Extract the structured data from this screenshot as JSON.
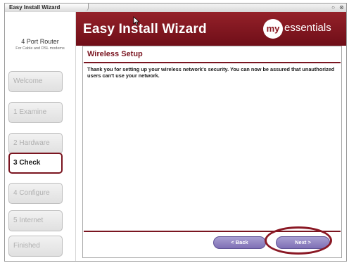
{
  "window": {
    "title": "Easy Install Wizard",
    "minimize_glyph": "○",
    "close_glyph": "⊗"
  },
  "sidebar": {
    "router_name": "4 Port Router",
    "router_subtitle": "For Cable and DSL modems",
    "steps": [
      {
        "label": "Welcome",
        "state": "inactive"
      },
      {
        "label": "1 Examine",
        "state": "inactive"
      },
      {
        "label": "2 Hardware",
        "state": "inactive"
      },
      {
        "label": "3 Check",
        "state": "active"
      },
      {
        "label": "4 Configure",
        "state": "inactive"
      },
      {
        "label": "5 Internet",
        "state": "inactive"
      },
      {
        "label": "Finished",
        "state": "inactive"
      }
    ]
  },
  "header": {
    "title": "Easy Install Wizard",
    "logo_mark": "my",
    "logo_text": "essentials"
  },
  "content": {
    "section_title": "Wireless Setup",
    "message": "Thank you for setting up your wireless network's security.  You can now be assured that unauthorized users can't use your network."
  },
  "buttons": {
    "back_label": "< Back",
    "next_label": "Next >"
  },
  "colors": {
    "brand_maroon": "#7a1520",
    "button_purple": "#8f82c4",
    "highlight": "#8a1824"
  }
}
